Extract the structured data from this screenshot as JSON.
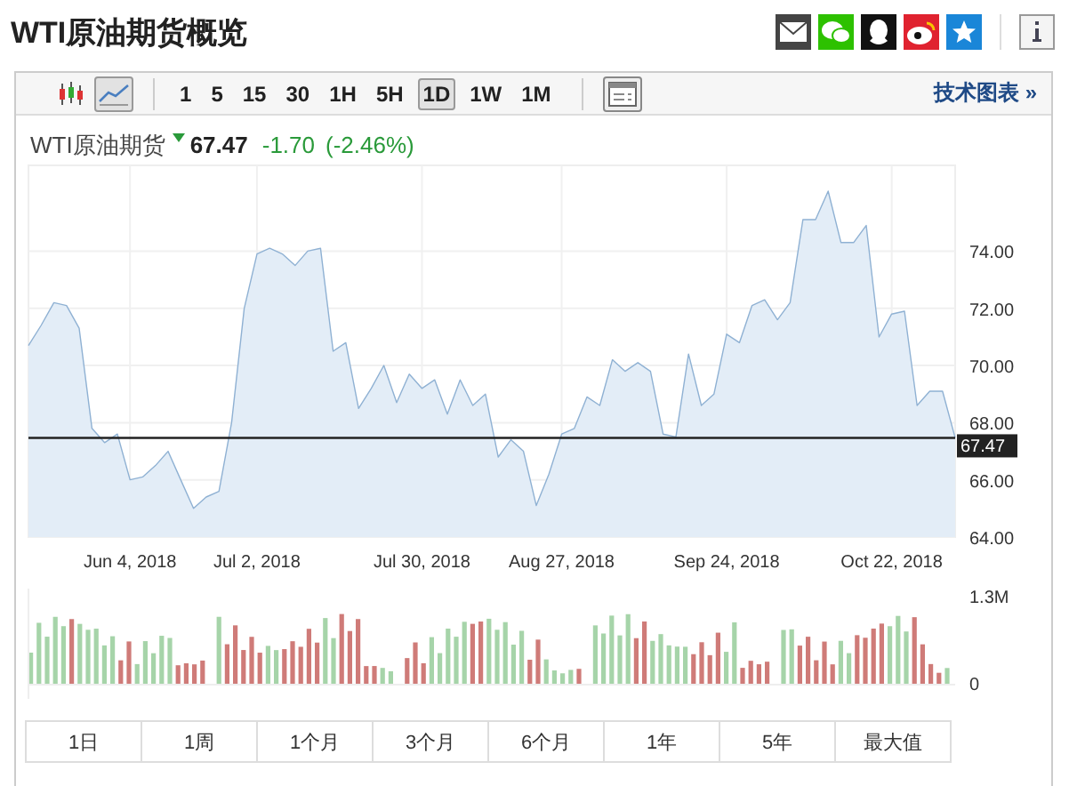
{
  "title": "WTI原油期货概览",
  "share_icons": [
    {
      "kind": "mail",
      "color": "#444444"
    },
    {
      "kind": "wechat",
      "color": "#2dc100"
    },
    {
      "kind": "qq",
      "color": "#111111"
    },
    {
      "kind": "weibo",
      "color": "#e0222f"
    },
    {
      "kind": "star",
      "color": "#1a86d8"
    }
  ],
  "toolbar": {
    "chart_types": [
      {
        "kind": "candles",
        "selected": false
      },
      {
        "kind": "line",
        "selected": true
      }
    ],
    "intervals": [
      {
        "label": "1",
        "selected": false
      },
      {
        "label": "5",
        "selected": false
      },
      {
        "label": "15",
        "selected": false
      },
      {
        "label": "30",
        "selected": false
      },
      {
        "label": "1H",
        "selected": false
      },
      {
        "label": "5H",
        "selected": false
      },
      {
        "label": "1D",
        "selected": true
      },
      {
        "label": "1W",
        "selected": false
      },
      {
        "label": "1M",
        "selected": false
      }
    ],
    "link": "技术图表 »"
  },
  "quote": {
    "name": "WTI原油期货",
    "falling": true,
    "price": "67.47",
    "change": "-1.70",
    "change_pct": "(-2.46%)"
  },
  "chart_data": {
    "type": "area",
    "categories": [
      null,
      null,
      null,
      null,
      null,
      null,
      null,
      null,
      "Jun 4, 2018",
      null,
      null,
      null,
      null,
      null,
      null,
      null,
      null,
      null,
      "Jul 2, 2018",
      null,
      null,
      null,
      null,
      null,
      null,
      null,
      null,
      null,
      null,
      null,
      null,
      "Jul 30, 2018",
      null,
      null,
      null,
      null,
      null,
      null,
      null,
      null,
      null,
      null,
      "Aug 27, 2018",
      null,
      null,
      null,
      null,
      null,
      null,
      null,
      null,
      null,
      null,
      null,
      null,
      "Sep 24, 2018",
      null,
      null,
      null,
      null,
      null,
      null,
      null,
      null,
      null,
      null,
      null,
      null,
      "Oct 22, 2018",
      null,
      null,
      null,
      null,
      null
    ],
    "values": [
      70.7,
      71.4,
      72.2,
      72.1,
      71.3,
      67.8,
      67.3,
      67.6,
      66.0,
      66.1,
      66.5,
      67.0,
      66.0,
      65.0,
      65.4,
      65.6,
      68.0,
      72.0,
      73.9,
      74.1,
      73.9,
      73.5,
      74.0,
      74.1,
      70.5,
      70.8,
      68.5,
      69.2,
      70.0,
      68.7,
      69.7,
      69.2,
      69.5,
      68.3,
      69.5,
      68.6,
      69.0,
      66.8,
      67.4,
      67.0,
      65.1,
      66.2,
      67.6,
      67.8,
      68.9,
      68.6,
      70.2,
      69.8,
      70.1,
      69.8,
      67.6,
      67.5,
      70.4,
      68.6,
      69.0,
      71.1,
      70.8,
      72.1,
      72.3,
      71.6,
      72.2,
      75.1,
      75.1,
      76.1,
      74.3,
      74.3,
      74.9,
      71.0,
      71.8,
      71.9,
      68.6,
      69.1,
      69.1,
      67.47
    ],
    "ylim": [
      64,
      77
    ],
    "grid": true,
    "yticks": [
      {
        "value": 64,
        "label": "64.00"
      },
      {
        "value": 66,
        "label": "66.00"
      },
      {
        "value": 68,
        "label": "68.00"
      },
      {
        "value": 70,
        "label": "70.00"
      },
      {
        "value": 72,
        "label": "72.00"
      },
      {
        "value": 74,
        "label": "74.00"
      }
    ],
    "ref_lines": [
      {
        "axis": "y",
        "value": 67.47,
        "label": "67.47"
      }
    ]
  },
  "volume": {
    "max_label": "1.3M",
    "zero_label": "0"
  },
  "ranges": [
    {
      "label": "1日",
      "selected": false
    },
    {
      "label": "1周",
      "selected": false
    },
    {
      "label": "1个月",
      "selected": false
    },
    {
      "label": "3个月",
      "selected": false
    },
    {
      "label": "6个月",
      "selected": false
    },
    {
      "label": "1年",
      "selected": false
    },
    {
      "label": "5年",
      "selected": false
    },
    {
      "label": "最大值",
      "selected": false
    }
  ]
}
